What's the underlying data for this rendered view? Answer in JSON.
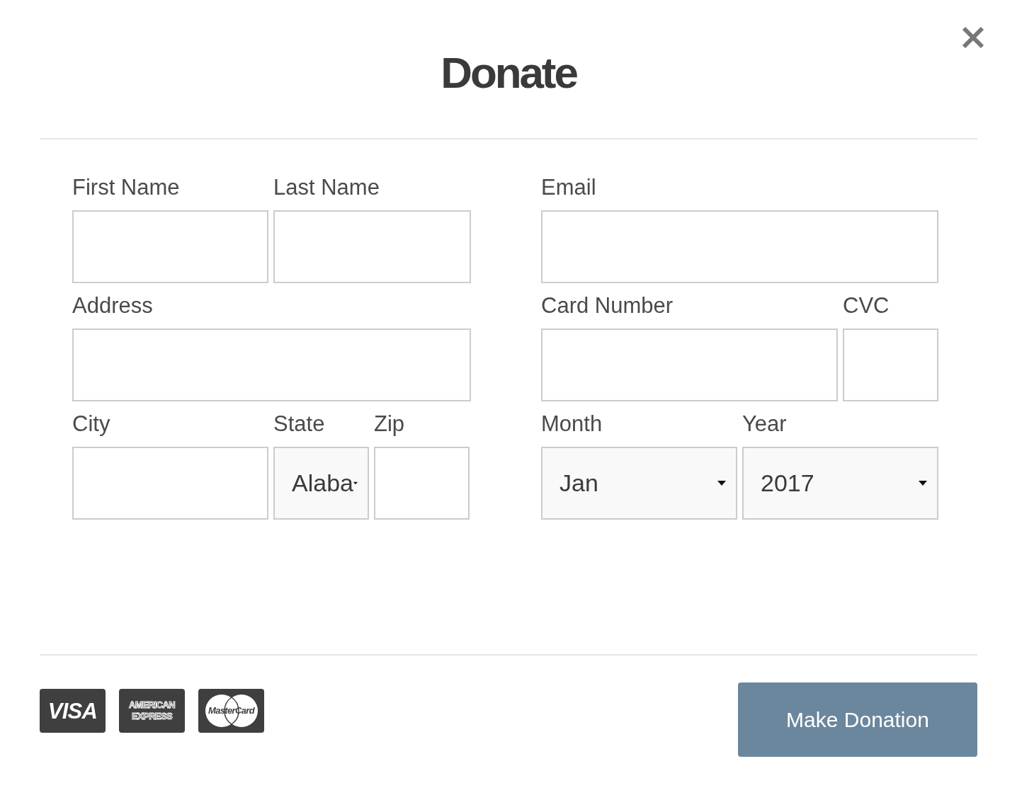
{
  "title": "Donate",
  "left_column": [
    {
      "fields": [
        {
          "label": "First Name",
          "kind": "text"
        },
        {
          "label": "Last Name",
          "kind": "text"
        }
      ]
    },
    {
      "fields": [
        {
          "label": "Address",
          "kind": "text"
        }
      ]
    },
    {
      "fields": [
        {
          "label": "City",
          "kind": "text"
        },
        {
          "label": "State",
          "kind": "select",
          "value": "Alaba"
        },
        {
          "label": "Zip",
          "kind": "text"
        }
      ]
    }
  ],
  "right_column": [
    {
      "fields": [
        {
          "label": "Email",
          "kind": "text"
        }
      ]
    },
    {
      "fields": [
        {
          "label": "Card Number",
          "kind": "text"
        },
        {
          "label": "CVC",
          "kind": "text"
        }
      ]
    },
    {
      "fields": [
        {
          "label": "Month",
          "kind": "select",
          "value": "Jan"
        },
        {
          "label": "Year",
          "kind": "select",
          "value": "2017"
        }
      ]
    }
  ],
  "card_logos": [
    {
      "kind": "visa",
      "lines": [
        "VISA"
      ]
    },
    {
      "kind": "amex",
      "lines": [
        "AMERICAN",
        "EXPRESS"
      ]
    },
    {
      "kind": "mastercard",
      "lines": [
        "MasterCard"
      ]
    }
  ],
  "submit_button": "Make Donation"
}
